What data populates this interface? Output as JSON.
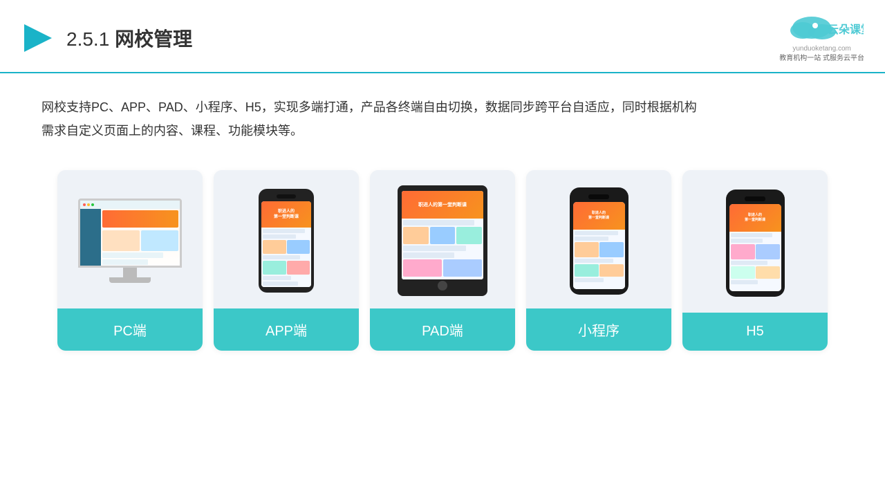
{
  "header": {
    "title_num": "2.5.1",
    "title_cn": "网校管理",
    "logo_name": "云朵课堂",
    "logo_url": "yunduoketang.com",
    "logo_tagline": "教育机构一站\n式服务云平台"
  },
  "description": {
    "text1": "网校支持PC、APP、PAD、小程序、H5，实现多端打通，产品各终端自由切换，数据同步跨平台自适应，同时根据机构",
    "text2": "需求自定义页面上的内容、课程、功能模块等。"
  },
  "cards": [
    {
      "id": "pc",
      "label": "PC端"
    },
    {
      "id": "app",
      "label": "APP端"
    },
    {
      "id": "pad",
      "label": "PAD端"
    },
    {
      "id": "mini",
      "label": "小程序"
    },
    {
      "id": "h5",
      "label": "H5"
    }
  ],
  "accent_color": "#3cc8c8"
}
